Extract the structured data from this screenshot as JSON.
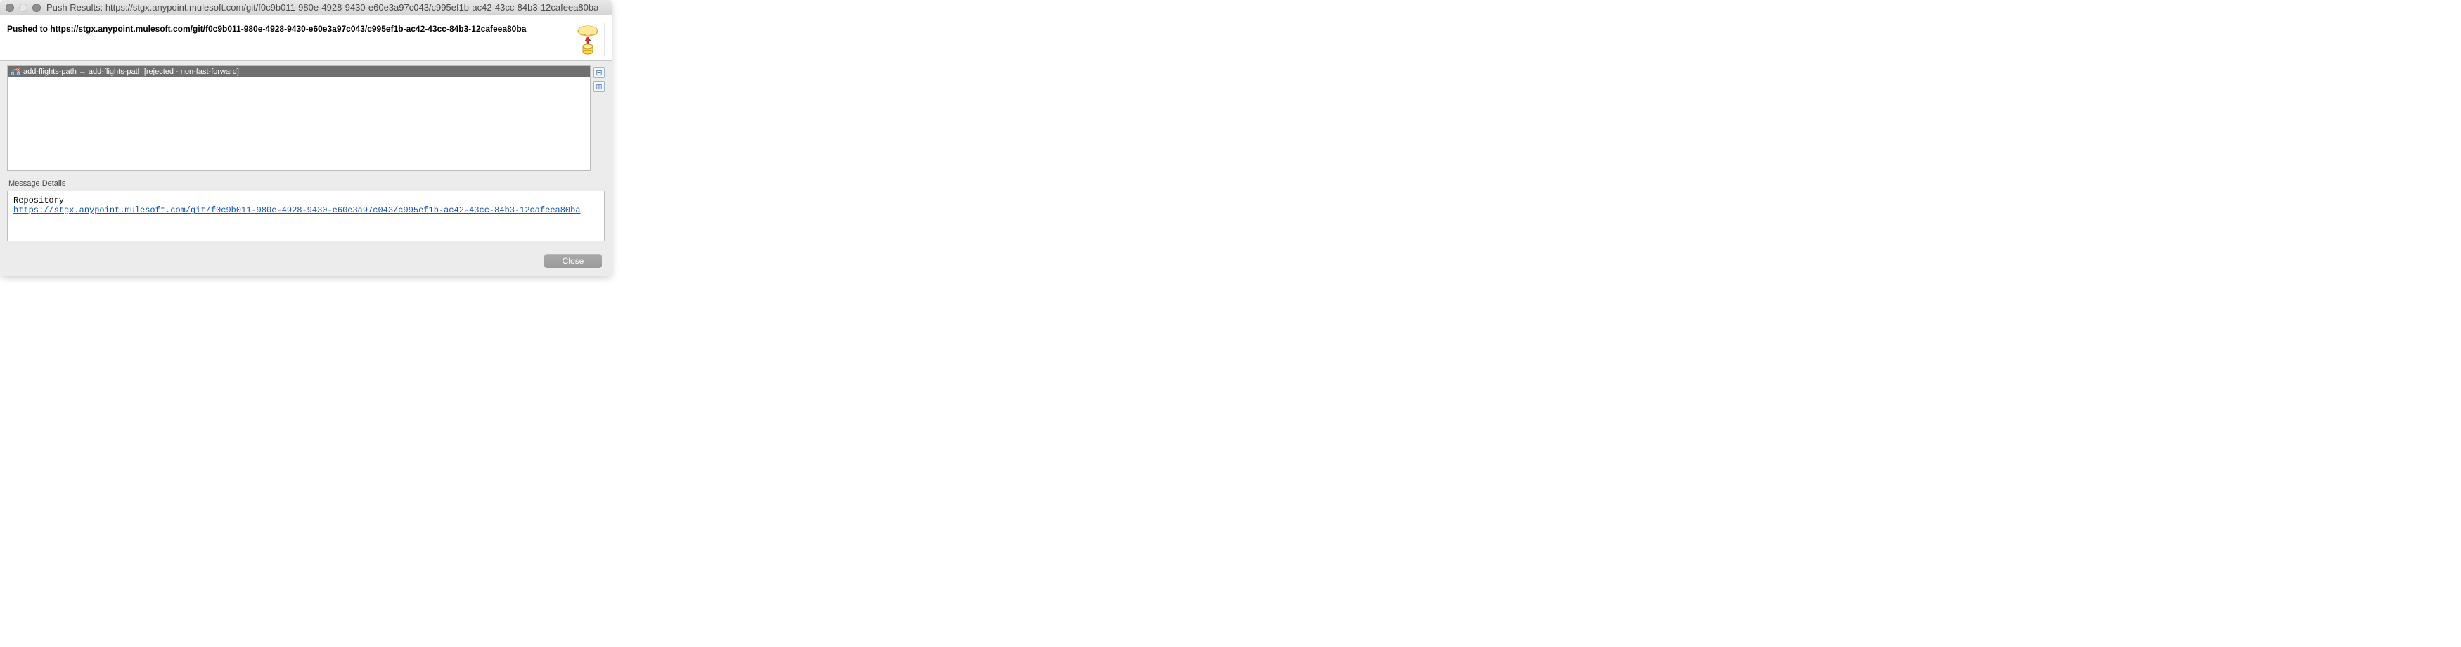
{
  "window": {
    "title": "Push Results: https://stgx.anypoint.mulesoft.com/git/f0c9b011-980e-4928-9430-e60e3a97c043/c995ef1b-ac42-43cc-84b3-12cafeea80ba"
  },
  "header": {
    "text": "Pushed to https://stgx.anypoint.mulesoft.com/git/f0c9b011-980e-4928-9430-e60e3a97c043/c995ef1b-ac42-43cc-84b3-12cafeea80ba"
  },
  "results": {
    "items": [
      {
        "text": "add-flights-path → add-flights-path [rejected - non-fast-forward]"
      }
    ]
  },
  "sideButtons": {
    "collapse": "⊟",
    "expand": "⊞"
  },
  "details": {
    "sectionLabel": "Message Details",
    "repoLabel": "Repository",
    "repoUrl": "https://stgx.anypoint.mulesoft.com/git/f0c9b011-980e-4928-9430-e60e3a97c043/c995ef1b-ac42-43cc-84b3-12cafeea80ba"
  },
  "buttons": {
    "close": "Close"
  }
}
